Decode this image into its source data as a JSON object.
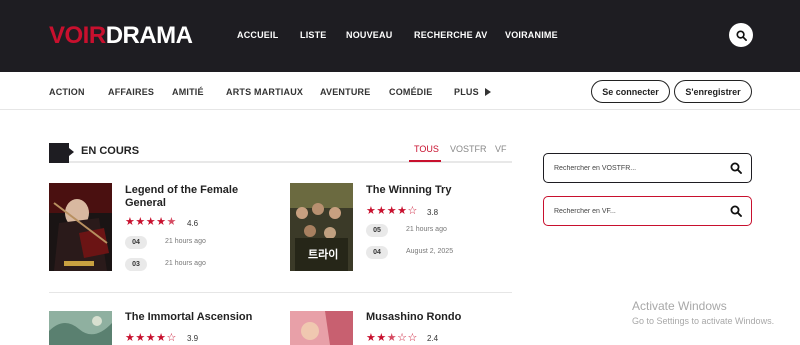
{
  "header": {
    "logo_part1": "VOIR",
    "logo_part2": "DRAMA",
    "nav": [
      "ACCUEIL",
      "LISTE",
      "NOUVEAU",
      "RECHERCHE AV",
      "VOIRANIME"
    ]
  },
  "categories": [
    "ACTION",
    "AFFAIRES",
    "AMITIÉ",
    "ARTS MARTIAUX",
    "AVENTURE",
    "COMÉDIE",
    "PLUS"
  ],
  "auth": {
    "login": "Se connecter",
    "register": "S'enregistrer"
  },
  "section": {
    "title": "EN COURS",
    "tabs": [
      "TOUS",
      "VOSTFR",
      "VF"
    ],
    "active_tab": "TOUS"
  },
  "dramas": [
    {
      "title": "Legend of the Female General",
      "rating": "4.6",
      "stars": 4.5,
      "episodes": [
        {
          "ep": "04",
          "time": "21 hours ago"
        },
        {
          "ep": "03",
          "time": "21 hours ago"
        }
      ]
    },
    {
      "title": "The Winning Try",
      "rating": "3.8",
      "stars": 4,
      "episodes": [
        {
          "ep": "05",
          "time": "21 hours ago"
        },
        {
          "ep": "04",
          "time": "August 2, 2025"
        }
      ]
    },
    {
      "title": "The Immortal Ascension",
      "rating": "3.9",
      "stars": 4,
      "episodes": []
    },
    {
      "title": "Musashino Rondo",
      "rating": "2.4",
      "stars": 2.5,
      "episodes": []
    }
  ],
  "sidebar": {
    "search_vostfr_placeholder": "Rechercher en VOSTFR...",
    "search_vf_placeholder": "Rechercher en VF..."
  },
  "watermark": {
    "line1": "Activate Windows",
    "line2": "Go to Settings to activate Windows."
  },
  "colors": {
    "accent": "#c8102e",
    "header_bg": "#1e1d22"
  },
  "icons": [
    "search-icon",
    "play-triangle-icon",
    "star-icon"
  ]
}
